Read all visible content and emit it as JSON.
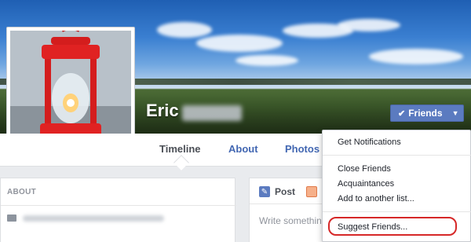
{
  "profile": {
    "name": "Eric",
    "friends_button": {
      "label": "Friends"
    }
  },
  "nav": {
    "tabs": [
      {
        "label": "Timeline"
      },
      {
        "label": "About"
      },
      {
        "label": "Photos"
      }
    ]
  },
  "about_card": {
    "title": "ABOUT"
  },
  "composer": {
    "post_label": "Post",
    "placeholder": "Write somethin"
  },
  "menu": {
    "items": [
      {
        "label": "Get Notifications"
      },
      {
        "label": "Close Friends"
      },
      {
        "label": "Acquaintances"
      },
      {
        "label": "Add to another list..."
      },
      {
        "label": "Suggest Friends..."
      }
    ]
  },
  "colors": {
    "brand_blue": "#5b7bc0",
    "link_blue": "#4267b2",
    "highlight_red": "#d62828"
  }
}
